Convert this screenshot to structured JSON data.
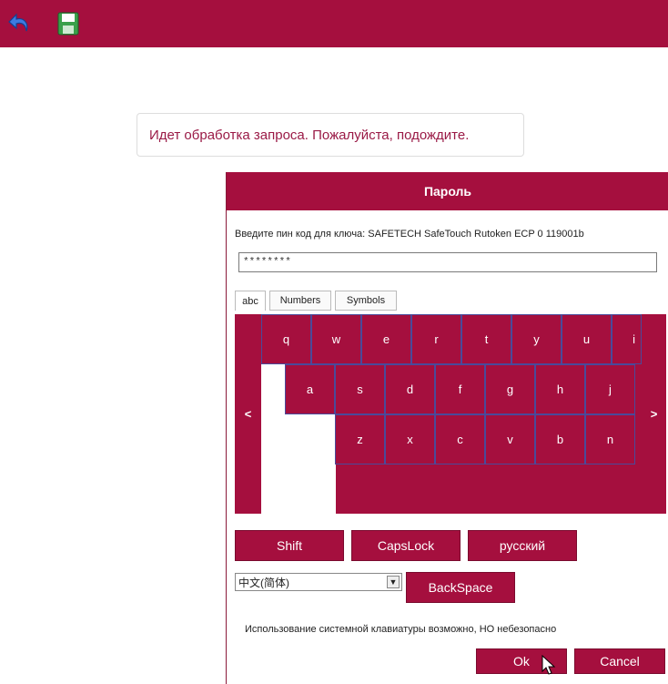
{
  "toolbar": {
    "undo_icon": "undo-arrow-icon",
    "save_icon": "floppy-disk-save-icon",
    "bar_color": "#a50f3e"
  },
  "status": {
    "message": "Идет обработка запроса. Пожалуйста, подождите.",
    "text_color": "#9a1a46"
  },
  "dialog": {
    "title": "Пароль",
    "prompt": "Введите пин код для ключа: SAFETECH SafeTouch Rutoken ECP 0 119001b",
    "pin_value": "********",
    "tabs": [
      {
        "label": "abc",
        "active": true
      },
      {
        "label": "Numbers",
        "active": false
      },
      {
        "label": "Symbols",
        "active": false
      }
    ],
    "keyboard": {
      "left_arrow": "<",
      "right_arrow": ">",
      "row1": [
        "q",
        "w",
        "e",
        "r",
        "t",
        "y",
        "u",
        "i"
      ],
      "row2": [
        "a",
        "s",
        "d",
        "f",
        "g",
        "h",
        "j"
      ],
      "row3": [
        "z",
        "x",
        "c",
        "v",
        "b",
        "n"
      ]
    },
    "buttons": {
      "shift": "Shift",
      "capslock": "CapsLock",
      "layout": "русский",
      "backspace": "BackSpace",
      "ok": "Ok",
      "cancel": "Cancel"
    },
    "ime_selected": "中文(简体)",
    "note": "Использование системной клавиатуры возможно, НО небезопасно",
    "accent_color": "#a50f3e",
    "key_border_color": "#4a4a9a"
  }
}
